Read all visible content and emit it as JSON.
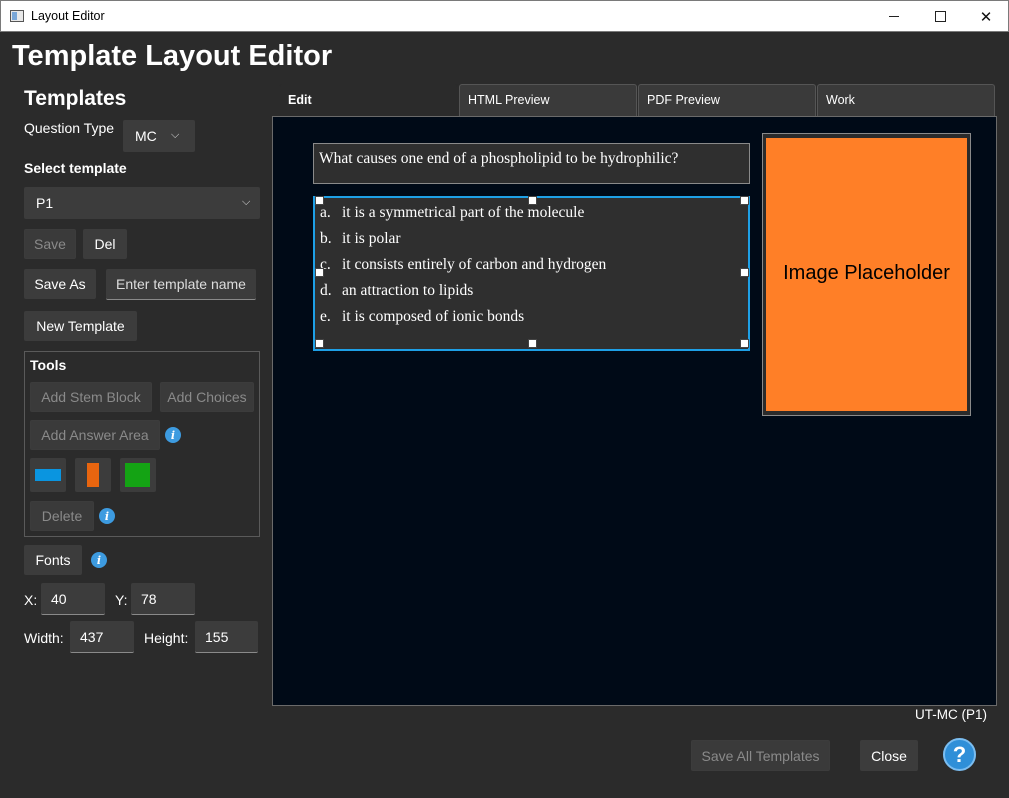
{
  "window": {
    "title": "Layout Editor"
  },
  "app": {
    "heading": "Template Layout Editor"
  },
  "sidebar": {
    "templates_heading": "Templates",
    "question_type_label": "Question Type",
    "question_type_value": "MC",
    "select_template_label": "Select template",
    "selected_template": "P1",
    "save_label": "Save",
    "delete_label": "Del",
    "save_as_label": "Save As",
    "template_name_placeholder": "Enter template name",
    "new_template_label": "New Template",
    "tools": {
      "heading": "Tools",
      "add_stem_block": "Add Stem Block",
      "add_choices": "Add Choices",
      "add_answer_area": "Add Answer Area",
      "delete_label": "Delete",
      "colors": [
        "#0a95e0",
        "#e8650f",
        "#14a314"
      ]
    },
    "fonts_label": "Fonts",
    "x_label": "X:",
    "x_value": "40",
    "y_label": "Y:",
    "y_value": "78",
    "width_label": "Width:",
    "width_value": "437",
    "height_label": "Height:",
    "height_value": "155"
  },
  "tabs": [
    {
      "label": "Edit",
      "active": true
    },
    {
      "label": "HTML Preview",
      "active": false
    },
    {
      "label": "PDF Preview",
      "active": false
    },
    {
      "label": "Work",
      "active": false
    }
  ],
  "canvas": {
    "stem_text": "What causes one end of a phospholipid to be hydrophilic?",
    "choices": [
      {
        "letter": "a.",
        "text": "it is a symmetrical part of the molecule"
      },
      {
        "letter": "b.",
        "text": "it is polar"
      },
      {
        "letter": "c.",
        "text": "it consists entirely of carbon and hydrogen"
      },
      {
        "letter": "d.",
        "text": "an attraction to lipids"
      },
      {
        "letter": "e.",
        "text": "it is composed of ionic bonds"
      }
    ],
    "image_placeholder": "Image Placeholder"
  },
  "footer": {
    "status": "UT-MC (P1)",
    "save_all_label": "Save All Templates",
    "close_label": "Close",
    "help_label": "?"
  }
}
